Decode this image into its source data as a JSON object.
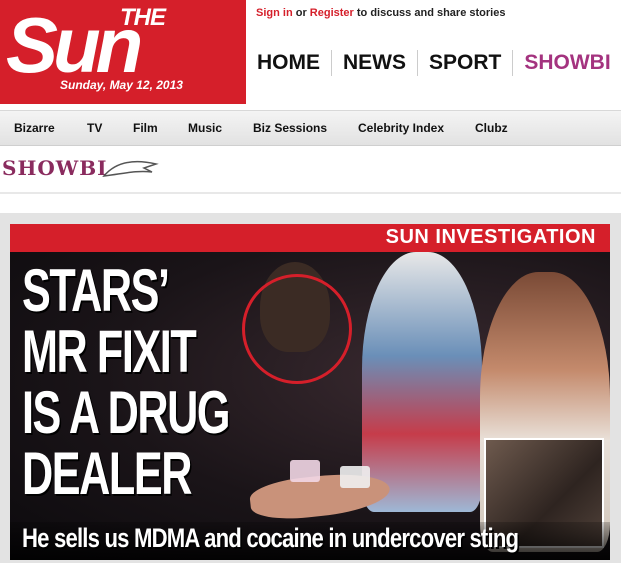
{
  "masthead": {
    "logo_the": "THE",
    "logo_sun": "Sun",
    "date": "Sunday, May 12, 2013"
  },
  "account": {
    "signin_label": "Sign in",
    "or_label": "or",
    "register_label": "Register",
    "prompt": "to discuss and share stories"
  },
  "main_nav": {
    "items": [
      "HOME",
      "NEWS",
      "SPORT",
      "SHOWBI"
    ]
  },
  "sub_nav": {
    "items": [
      "Bizarre",
      "TV",
      "Film",
      "Music",
      "Biz Sessions",
      "Celebrity Index",
      "Clubz"
    ]
  },
  "section": {
    "logo_text": "SHOWBI"
  },
  "hero": {
    "banner": "SUN INVESTIGATION",
    "headline_lines": [
      "STARS’",
      "MR FIXIT",
      "IS A DRUG",
      "DEALER"
    ],
    "strapline": "He sells us MDMA and cocaine in undercover sting"
  },
  "colors": {
    "brand_red": "#d51f2a",
    "showbiz_purple": "#a4337f"
  }
}
